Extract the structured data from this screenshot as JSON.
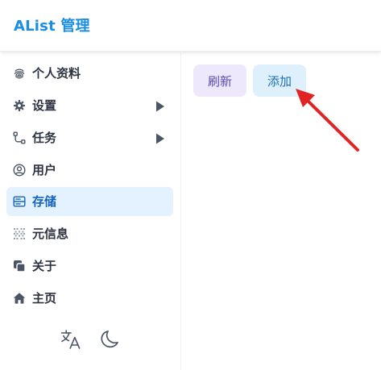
{
  "header": {
    "title": "AList 管理"
  },
  "sidebar": {
    "items": [
      {
        "label": "个人资料",
        "icon": "fingerprint-icon"
      },
      {
        "label": "设置",
        "icon": "gear-icon"
      },
      {
        "label": "任务",
        "icon": "workflow-icon"
      },
      {
        "label": "用户",
        "icon": "user-circle-icon"
      },
      {
        "label": "存储",
        "icon": "storage-icon"
      },
      {
        "label": "元信息",
        "icon": "metadata-grid-icon"
      },
      {
        "label": "关于",
        "icon": "copy-icon"
      },
      {
        "label": "主页",
        "icon": "home-icon"
      }
    ],
    "active_index": 4,
    "footer": {
      "language_icon": "translate-icon",
      "theme_icon": "moon-icon"
    }
  },
  "toolbar": {
    "refresh_label": "刷新",
    "add_label": "添加"
  },
  "colors": {
    "brand": "#1a8ee0",
    "active_bg": "#e4f1fe",
    "refresh_bg": "#ede8fc",
    "add_bg": "#dff0fd",
    "annotation_arrow": "#e02424"
  }
}
